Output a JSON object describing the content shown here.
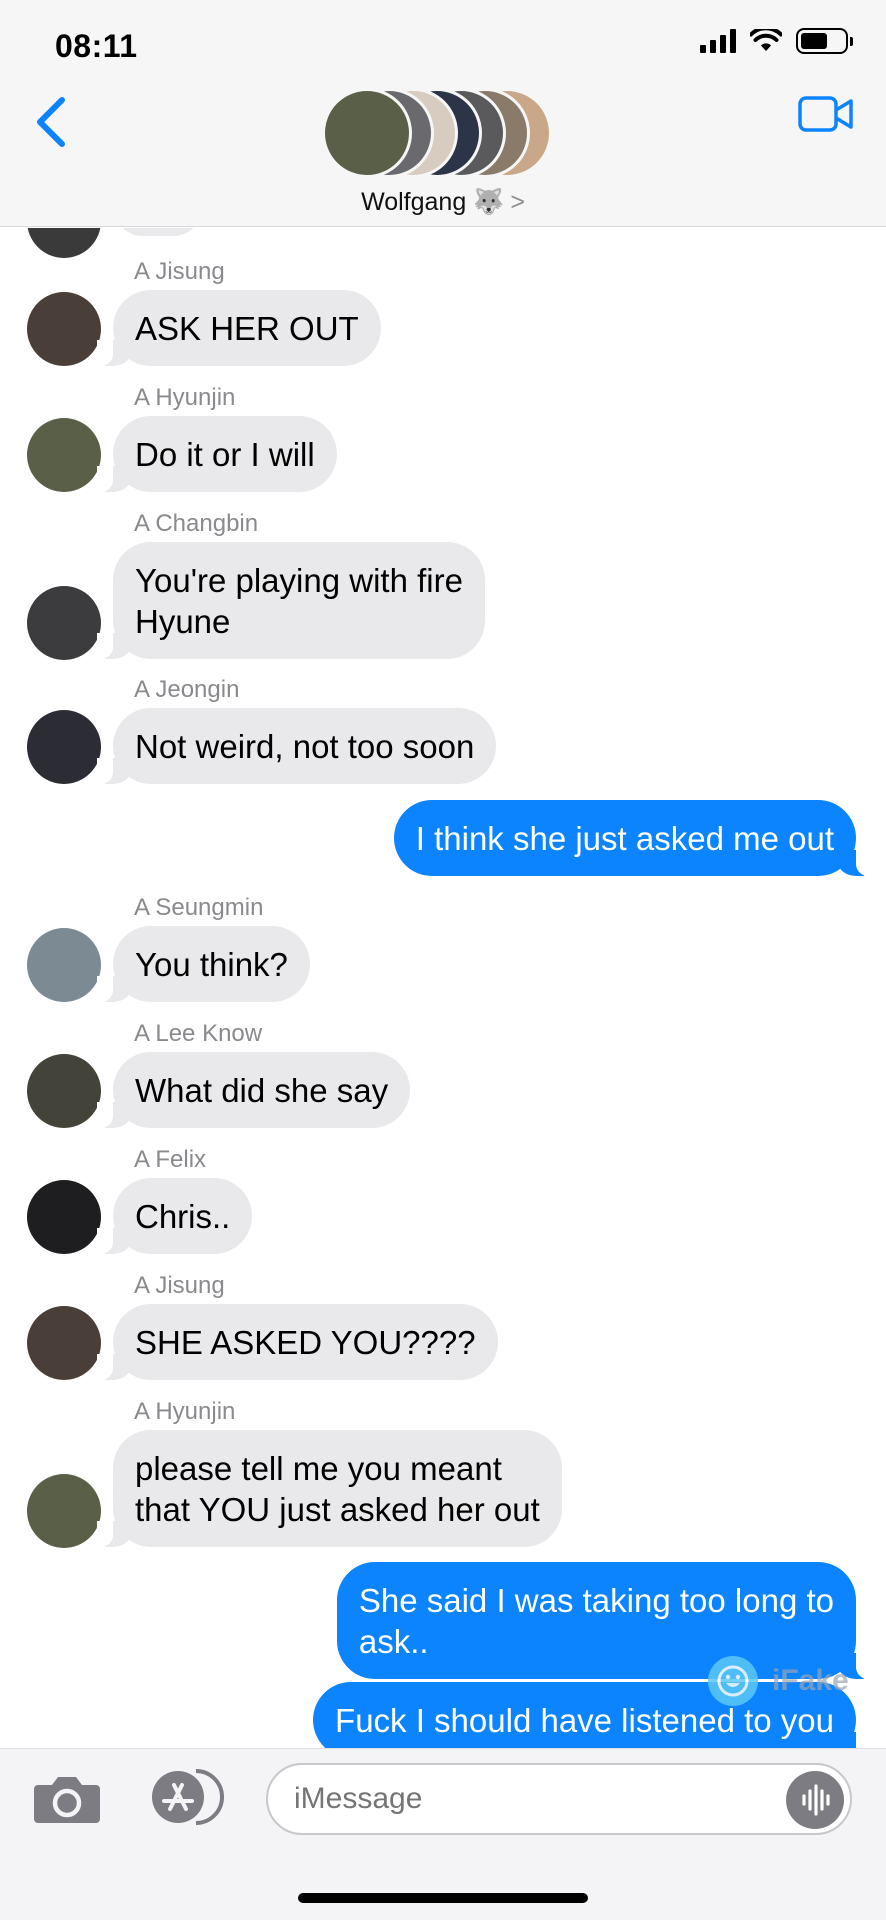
{
  "status_bar": {
    "time": "08:11"
  },
  "header": {
    "group_name": "Wolfgang 🐺",
    "chevron": ">"
  },
  "avatar_colors": {
    "jisung": "#4a3f38",
    "hyunjin": "#5a6048",
    "changbin": "#3c3c3e",
    "jeongin": "#2c2c34",
    "seungmin": "#7c8a94",
    "leeknow": "#44433a",
    "felix": "#1e1e20"
  },
  "messages": [
    {
      "type": "in",
      "sender": "A Jisung",
      "text": "ASK HER OUT",
      "avatar": "jisung"
    },
    {
      "type": "in",
      "sender": "A Hyunjin",
      "text": "Do it or I will",
      "avatar": "hyunjin"
    },
    {
      "type": "in",
      "sender": "A Changbin",
      "text": "You're playing with fire\nHyune",
      "avatar": "changbin"
    },
    {
      "type": "in",
      "sender": "A Jeongin",
      "text": "Not weird, not too soon",
      "avatar": "jeongin"
    },
    {
      "type": "out",
      "text": "I think she just asked me out"
    },
    {
      "type": "in",
      "sender": "A Seungmin",
      "text": "You think?",
      "avatar": "seungmin"
    },
    {
      "type": "in",
      "sender": "A Lee Know",
      "text": "What did she say",
      "avatar": "leeknow"
    },
    {
      "type": "in",
      "sender": "A Felix",
      "text": "Chris..",
      "avatar": "felix"
    },
    {
      "type": "in",
      "sender": "A Jisung",
      "text": "SHE ASKED YOU????",
      "avatar": "jisung"
    },
    {
      "type": "in",
      "sender": "A Hyunjin",
      "text": "please tell me you meant\nthat YOU just asked her out",
      "avatar": "hyunjin"
    },
    {
      "type": "out",
      "text": "She said I was taking too long to\nask.."
    },
    {
      "type": "out",
      "text": "Fuck I should have listened to you"
    }
  ],
  "watermark": {
    "text": "iFake"
  },
  "input": {
    "placeholder": "iMessage"
  }
}
